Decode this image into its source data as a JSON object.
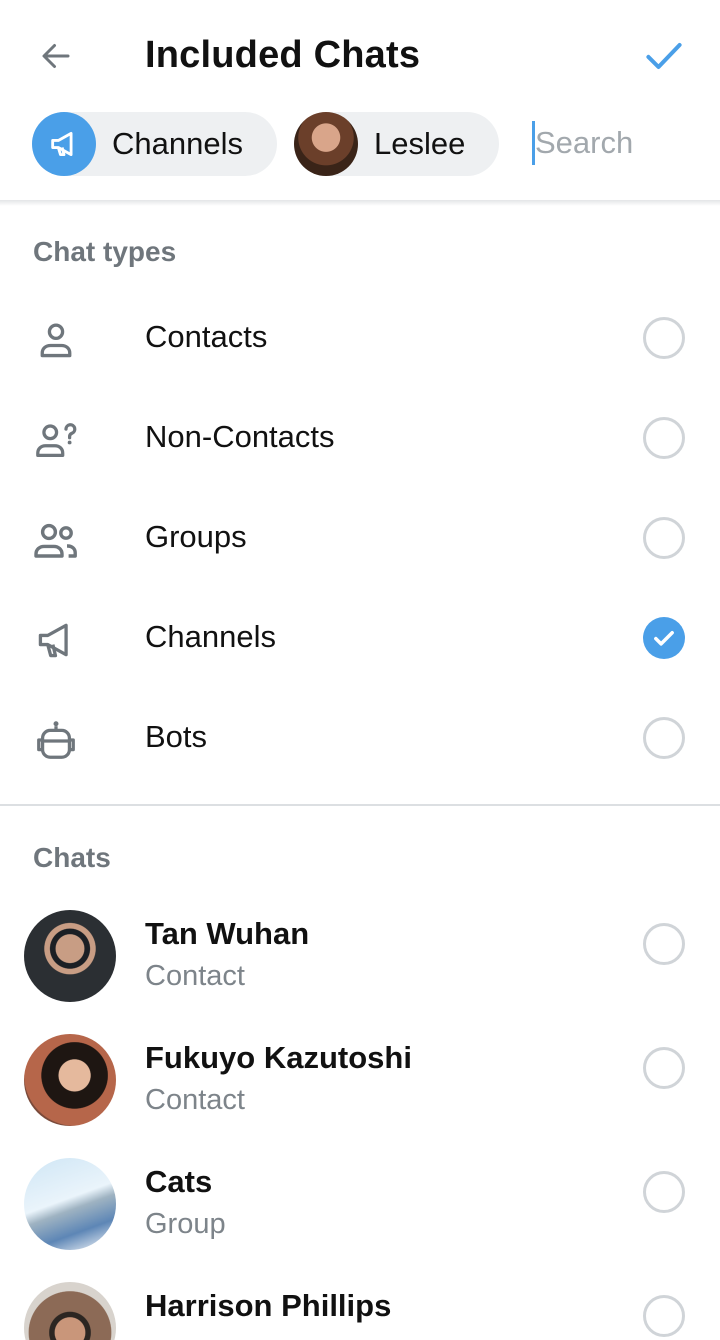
{
  "header": {
    "title": "Included Chats",
    "back_icon": "arrow-left-icon",
    "done_icon": "checkmark-icon",
    "accent_color": "#4a9fe8"
  },
  "selected_chips": [
    {
      "label": "Channels",
      "icon": "megaphone-icon"
    },
    {
      "label": "Leslee",
      "icon": "avatar"
    }
  ],
  "search": {
    "placeholder": "Search",
    "value": ""
  },
  "chat_types": {
    "title": "Chat types",
    "items": [
      {
        "label": "Contacts",
        "icon": "person-icon",
        "checked": false
      },
      {
        "label": "Non-Contacts",
        "icon": "person-question-icon",
        "checked": false
      },
      {
        "label": "Groups",
        "icon": "group-icon",
        "checked": false
      },
      {
        "label": "Channels",
        "icon": "megaphone-icon",
        "checked": true
      },
      {
        "label": "Bots",
        "icon": "robot-icon",
        "checked": false
      }
    ]
  },
  "chats": {
    "title": "Chats",
    "items": [
      {
        "name": "Tan Wuhan",
        "subtitle": "Contact",
        "checked": false
      },
      {
        "name": "Fukuyo Kazutoshi",
        "subtitle": "Contact",
        "checked": false
      },
      {
        "name": "Cats",
        "subtitle": "Group",
        "checked": false
      },
      {
        "name": "Harrison Phillips",
        "subtitle": "",
        "checked": false
      }
    ]
  }
}
